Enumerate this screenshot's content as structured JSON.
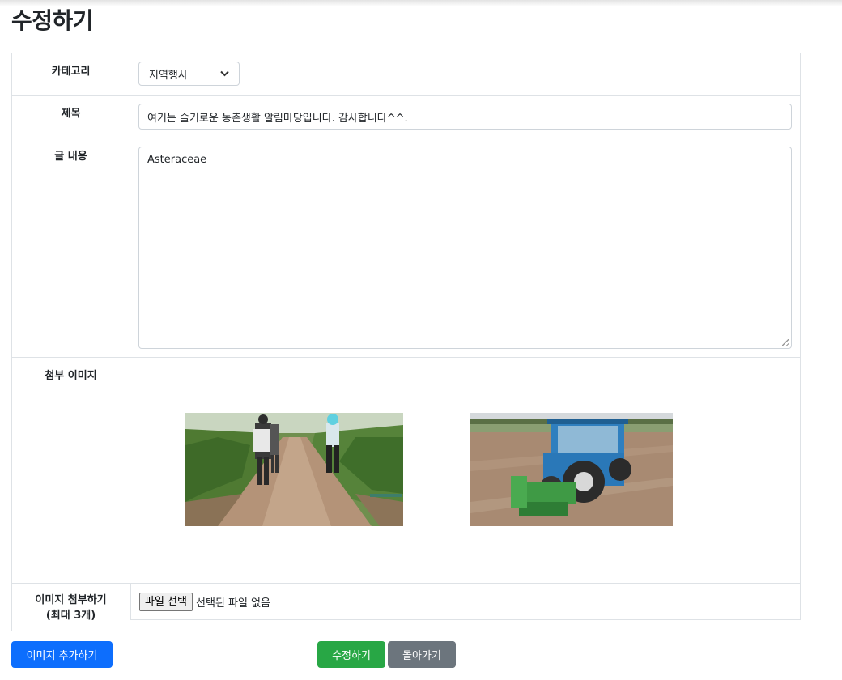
{
  "page": {
    "title": "수정하기"
  },
  "form": {
    "category": {
      "label": "카테고리",
      "selected": "지역행사"
    },
    "subject": {
      "label": "제목",
      "value": "여기는 슬기로운 농촌생활 알림마당입니다. 감사합니다^^."
    },
    "content": {
      "label": "글 내용",
      "value": "Asteraceae"
    },
    "attached": {
      "label": "첨부 이미지",
      "images": [
        {
          "name": "orchard-workers-photo"
        },
        {
          "name": "blue-tractor-photo"
        }
      ]
    },
    "upload": {
      "label_line1": "이미지 첨부하기",
      "label_line2": "(최대 3개)",
      "choose_button": "파일 선택",
      "status": "선택된 파일 없음"
    }
  },
  "buttons": {
    "add_image": "이미지 추가하기",
    "submit": "수정하기",
    "back": "돌아가기"
  },
  "colors": {
    "primary": "#0d6efd",
    "success": "#28a745",
    "secondary": "#6c757d",
    "border": "#dee2e6"
  },
  "icons": {
    "select_chevron": "chevron-down-icon",
    "resize": "resize-handle-icon"
  }
}
